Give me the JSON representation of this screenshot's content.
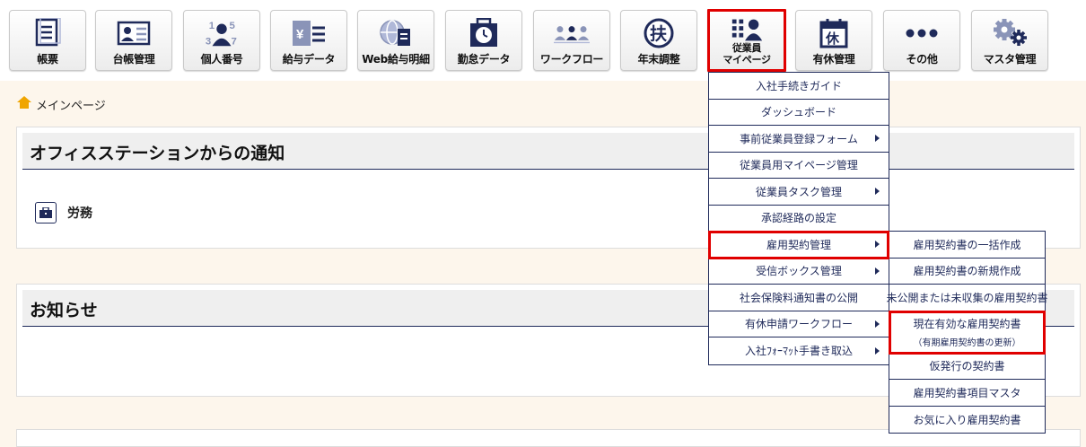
{
  "toolbar": {
    "buttons": [
      {
        "label": "帳票",
        "icon": "document-icon"
      },
      {
        "label": "台帳管理",
        "icon": "ledger-icon"
      },
      {
        "label": "個人番号",
        "icon": "personal-number-icon"
      },
      {
        "label": "給与データ",
        "icon": "payroll-icon"
      },
      {
        "label": "Web給与明細",
        "icon": "web-payslip-icon"
      },
      {
        "label": "勤怠データ",
        "icon": "attendance-icon"
      },
      {
        "label": "ワークフロー",
        "icon": "workflow-icon"
      },
      {
        "label": "年末調整",
        "icon": "year-end-adjustment-icon"
      },
      {
        "label": "従業員\nマイページ",
        "icon": "employee-mypage-icon"
      },
      {
        "label": "有休管理",
        "icon": "paid-leave-icon"
      },
      {
        "label": "その他",
        "icon": "more-icon"
      },
      {
        "label": "マスタ管理",
        "icon": "master-settings-icon"
      }
    ],
    "icon_glyphs": {
      "fu": "扶",
      "kyu": "休",
      "yen": "¥",
      "numbers": [
        "1",
        "5",
        "3",
        "7"
      ]
    }
  },
  "breadcrumb": {
    "label": "メインページ"
  },
  "notice_panel": {
    "title": "オフィスステーションからの通知",
    "category": "労務"
  },
  "info_panel": {
    "title": "お知らせ"
  },
  "employee_menu": {
    "items": [
      {
        "label": "入社手続きガイド",
        "has_sub": false
      },
      {
        "label": "ダッシュボード",
        "has_sub": false
      },
      {
        "label": "事前従業員登録フォーム",
        "has_sub": true
      },
      {
        "label": "従業員用マイページ管理",
        "has_sub": false
      },
      {
        "label": "従業員タスク管理",
        "has_sub": true
      },
      {
        "label": "承認経路の設定",
        "has_sub": false
      },
      {
        "label": "雇用契約管理",
        "has_sub": true
      },
      {
        "label": "受信ボックス管理",
        "has_sub": true
      },
      {
        "label": "社会保険料通知書の公開",
        "has_sub": false
      },
      {
        "label": "有休申請ワークフロー",
        "has_sub": true
      },
      {
        "label": "入社ﾌｫｰﾏｯﾄ手書き取込",
        "has_sub": true
      }
    ]
  },
  "contract_menu": {
    "items": [
      {
        "label": "雇用契約書の一括作成"
      },
      {
        "label": "雇用契約書の新規作成"
      },
      {
        "label": "未公開または未収集の雇用契約書"
      },
      {
        "label": "現在有効な雇用契約書",
        "sub": "（有期雇用契約書の更新）"
      },
      {
        "label": "仮発行の契約書"
      },
      {
        "label": "雇用契約書項目マスタ"
      },
      {
        "label": "お気に入り雇用契約書"
      }
    ]
  },
  "colors": {
    "accent": "#1f2a5a",
    "highlight": "#e00000",
    "page_bg": "#fdf6ec"
  }
}
